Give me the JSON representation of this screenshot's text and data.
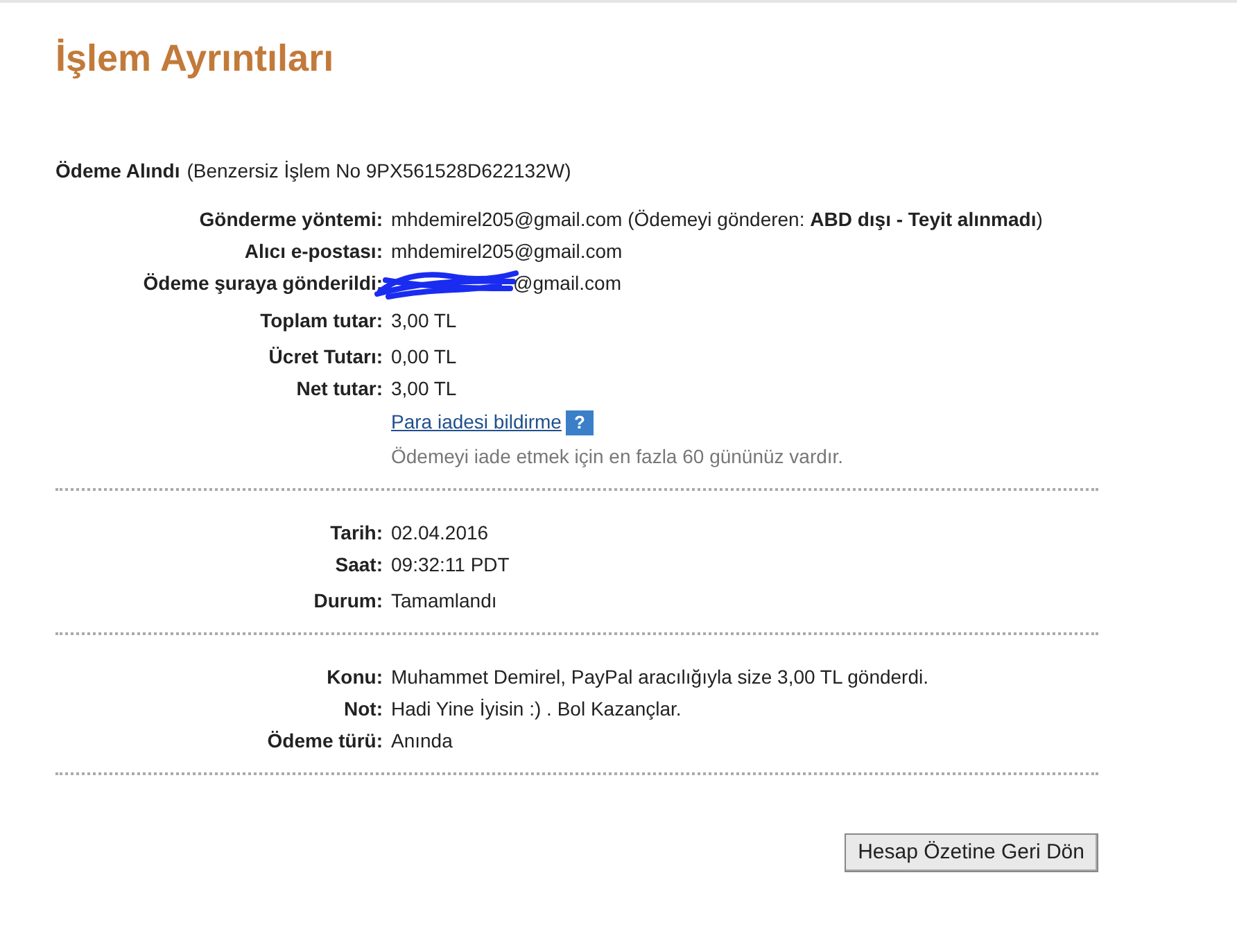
{
  "title": "İşlem Ayrıntıları",
  "heading": {
    "label": "Ödeme Alındı",
    "detail": "(Benzersiz İşlem No 9PX561528D622132W)"
  },
  "sections": [
    {
      "groups": [
        [
          {
            "kind": "text",
            "label": "Gönderme yöntemi:",
            "value": "mhdemirel205@gmail.com (Ödemeyi gönderen: **ABD dışı - Teyit alınmadı**)"
          },
          {
            "kind": "text",
            "label": "Alıcı e-postası:",
            "value": "mhdemirel205@gmail.com"
          },
          {
            "kind": "redacted",
            "label": "Ödeme şuraya gönderildi:",
            "value": "@gmail.com"
          }
        ],
        [
          {
            "kind": "text",
            "label": "Toplam tutar:",
            "value": "3,00 TL"
          }
        ],
        [
          {
            "kind": "text",
            "label": "Ücret Tutarı:",
            "value": "0,00 TL"
          },
          {
            "kind": "text",
            "label": "Net tutar:",
            "value": "3,00 TL"
          },
          {
            "kind": "link",
            "value": "Para iadesi bildirme",
            "icon": "?"
          },
          {
            "kind": "note",
            "value": "Ödemeyi iade etmek için en fazla 60 gününüz vardır."
          }
        ]
      ]
    },
    {
      "groups": [
        [
          {
            "kind": "text",
            "label": "Tarih:",
            "value": "02.04.2016"
          },
          {
            "kind": "text",
            "label": "Saat:",
            "value": "09:32:11 PDT"
          }
        ],
        [
          {
            "kind": "text",
            "label": "Durum:",
            "value": "Tamamlandı"
          }
        ]
      ]
    },
    {
      "groups": [
        [
          {
            "kind": "text",
            "label": "Konu:",
            "value": "Muhammet Demirel, PayPal aracılığıyla size 3,00 TL gönderdi."
          },
          {
            "kind": "text",
            "label": "Not:",
            "value": "Hadi Yine İyisin :) . Bol Kazançlar."
          },
          {
            "kind": "text",
            "label": "Ödeme türü:",
            "value": "Anında"
          }
        ]
      ]
    }
  ],
  "button": "Hesap Özetine Geri Dön"
}
